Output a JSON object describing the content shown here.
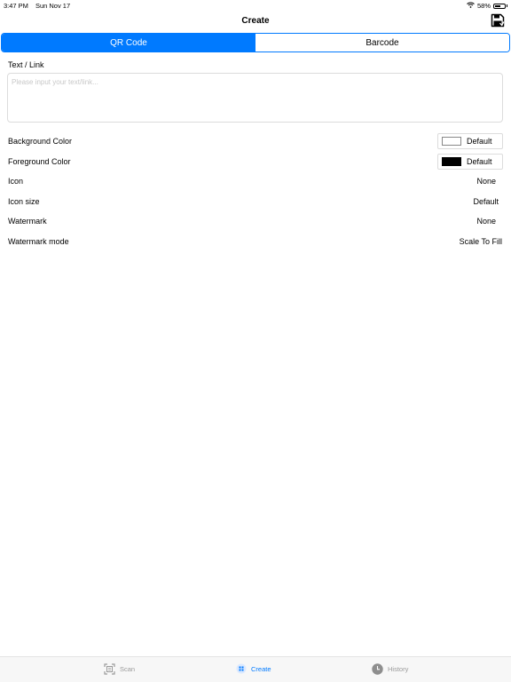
{
  "status_bar": {
    "time": "3:47 PM",
    "date": "Sun Nov 17",
    "battery_text": "58%",
    "battery_level": 0.58
  },
  "nav": {
    "title": "Create",
    "save_icon": "floppy-disk-icon"
  },
  "segments": [
    {
      "label": "QR Code",
      "selected": true
    },
    {
      "label": "Barcode",
      "selected": false
    }
  ],
  "text_section": {
    "label": "Text / Link",
    "placeholder": "Please input your text/link...",
    "value": ""
  },
  "settings": {
    "background_color": {
      "label": "Background Color",
      "value": "Default",
      "swatch": "#ffffff"
    },
    "foreground_color": {
      "label": "Foreground Color",
      "value": "Default",
      "swatch": "#000000"
    },
    "icon": {
      "label": "Icon",
      "value": "None"
    },
    "icon_size": {
      "label": "Icon size",
      "value": "Default"
    },
    "watermark": {
      "label": "Watermark",
      "value": "None"
    },
    "watermark_mode": {
      "label": "Watermark mode",
      "value": "Scale To Fill"
    }
  },
  "tab_bar": {
    "scan": {
      "label": "Scan",
      "icon": "scan-icon"
    },
    "create": {
      "label": "Create",
      "icon": "create-icon",
      "selected": true
    },
    "history": {
      "label": "History",
      "icon": "clock-icon"
    }
  },
  "colors": {
    "accent": "#007aff"
  }
}
